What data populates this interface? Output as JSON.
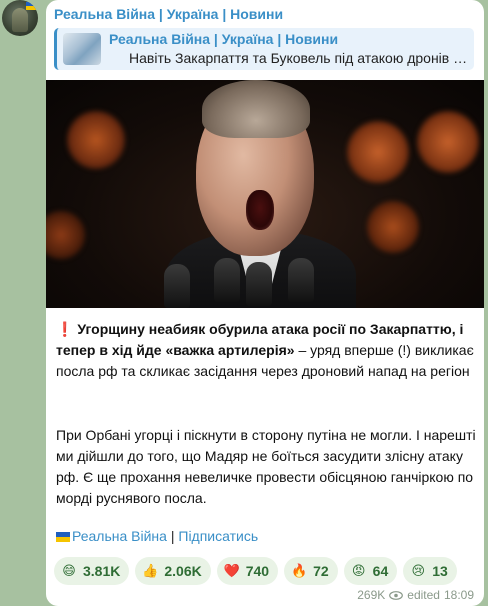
{
  "post": {
    "channel_name": "Реальна Війна | Україна | Новини",
    "reply": {
      "title": "Реальна Війна | Україна | Новини",
      "text": "Навіть Закарпаття та Буковель під атакою дронів …"
    },
    "paragraph1": {
      "mark": "❗",
      "bold": "Угорщину неабияк обурила атака росії по Закарпаттю, і тепер в хід йде «важка артилерія»",
      "rest": " – уряд вперше (!) викликає посла рф та скликає засідання через дроновий напад на регіон"
    },
    "paragraph2": "При Орбані угорці і піскнути в сторону путіна не могли. І нарешті ми дійшли до того, що Мадяр не боїться засудити злісну атаку рф. Є ще прохання невеличке провести обісцяною ганчіркою по морді руснявого посла.",
    "links": {
      "channel": "Реальна Війна",
      "separator": " | ",
      "subscribe": "Підписатись"
    },
    "reactions": [
      {
        "emoji": "😄",
        "icon": "grinning-face-icon",
        "count": "3.81K"
      },
      {
        "emoji": "👍",
        "icon": "thumbs-up-icon",
        "count": "2.06K"
      },
      {
        "emoji": "❤️",
        "icon": "heart-icon",
        "count": "740"
      },
      {
        "emoji": "🔥",
        "icon": "fire-icon",
        "count": "72"
      },
      {
        "emoji": "😡",
        "icon": "angry-face-icon",
        "count": "64"
      },
      {
        "emoji": "😢",
        "icon": "crying-face-icon",
        "count": "13"
      }
    ],
    "views": "269K",
    "edited_label": "edited",
    "time": "18:09"
  },
  "colors": {
    "accent": "#3a8fc7",
    "background": "#a7c1a0",
    "reaction_bg": "#e9f3e6",
    "reaction_text": "#2f6d35",
    "flag_blue": "#1f5fbf",
    "flag_yellow": "#f5c400"
  }
}
